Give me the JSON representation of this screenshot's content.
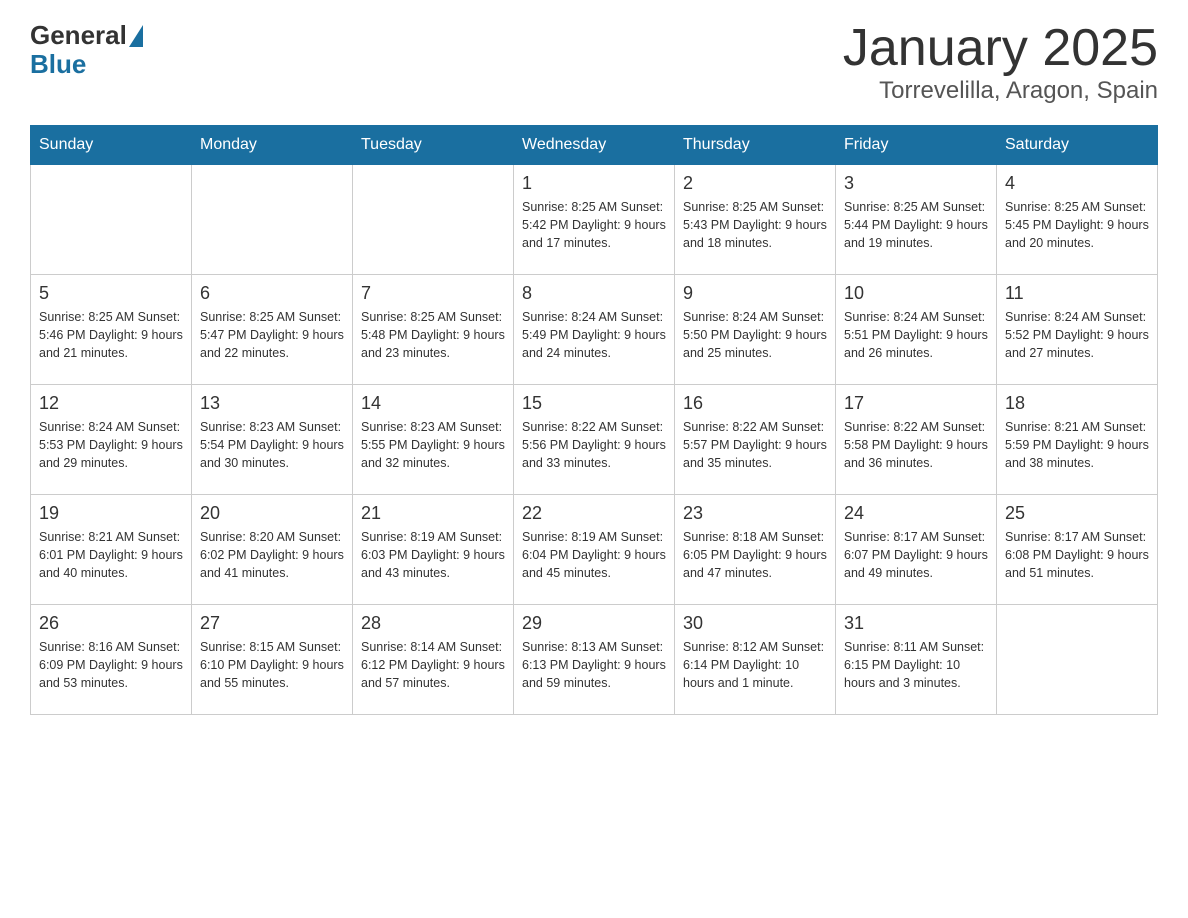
{
  "header": {
    "logo_general": "General",
    "logo_blue": "Blue",
    "title": "January 2025",
    "subtitle": "Torrevelilla, Aragon, Spain"
  },
  "days_of_week": [
    "Sunday",
    "Monday",
    "Tuesday",
    "Wednesday",
    "Thursday",
    "Friday",
    "Saturday"
  ],
  "weeks": [
    [
      {
        "day": "",
        "info": ""
      },
      {
        "day": "",
        "info": ""
      },
      {
        "day": "",
        "info": ""
      },
      {
        "day": "1",
        "info": "Sunrise: 8:25 AM\nSunset: 5:42 PM\nDaylight: 9 hours\nand 17 minutes."
      },
      {
        "day": "2",
        "info": "Sunrise: 8:25 AM\nSunset: 5:43 PM\nDaylight: 9 hours\nand 18 minutes."
      },
      {
        "day": "3",
        "info": "Sunrise: 8:25 AM\nSunset: 5:44 PM\nDaylight: 9 hours\nand 19 minutes."
      },
      {
        "day": "4",
        "info": "Sunrise: 8:25 AM\nSunset: 5:45 PM\nDaylight: 9 hours\nand 20 minutes."
      }
    ],
    [
      {
        "day": "5",
        "info": "Sunrise: 8:25 AM\nSunset: 5:46 PM\nDaylight: 9 hours\nand 21 minutes."
      },
      {
        "day": "6",
        "info": "Sunrise: 8:25 AM\nSunset: 5:47 PM\nDaylight: 9 hours\nand 22 minutes."
      },
      {
        "day": "7",
        "info": "Sunrise: 8:25 AM\nSunset: 5:48 PM\nDaylight: 9 hours\nand 23 minutes."
      },
      {
        "day": "8",
        "info": "Sunrise: 8:24 AM\nSunset: 5:49 PM\nDaylight: 9 hours\nand 24 minutes."
      },
      {
        "day": "9",
        "info": "Sunrise: 8:24 AM\nSunset: 5:50 PM\nDaylight: 9 hours\nand 25 minutes."
      },
      {
        "day": "10",
        "info": "Sunrise: 8:24 AM\nSunset: 5:51 PM\nDaylight: 9 hours\nand 26 minutes."
      },
      {
        "day": "11",
        "info": "Sunrise: 8:24 AM\nSunset: 5:52 PM\nDaylight: 9 hours\nand 27 minutes."
      }
    ],
    [
      {
        "day": "12",
        "info": "Sunrise: 8:24 AM\nSunset: 5:53 PM\nDaylight: 9 hours\nand 29 minutes."
      },
      {
        "day": "13",
        "info": "Sunrise: 8:23 AM\nSunset: 5:54 PM\nDaylight: 9 hours\nand 30 minutes."
      },
      {
        "day": "14",
        "info": "Sunrise: 8:23 AM\nSunset: 5:55 PM\nDaylight: 9 hours\nand 32 minutes."
      },
      {
        "day": "15",
        "info": "Sunrise: 8:22 AM\nSunset: 5:56 PM\nDaylight: 9 hours\nand 33 minutes."
      },
      {
        "day": "16",
        "info": "Sunrise: 8:22 AM\nSunset: 5:57 PM\nDaylight: 9 hours\nand 35 minutes."
      },
      {
        "day": "17",
        "info": "Sunrise: 8:22 AM\nSunset: 5:58 PM\nDaylight: 9 hours\nand 36 minutes."
      },
      {
        "day": "18",
        "info": "Sunrise: 8:21 AM\nSunset: 5:59 PM\nDaylight: 9 hours\nand 38 minutes."
      }
    ],
    [
      {
        "day": "19",
        "info": "Sunrise: 8:21 AM\nSunset: 6:01 PM\nDaylight: 9 hours\nand 40 minutes."
      },
      {
        "day": "20",
        "info": "Sunrise: 8:20 AM\nSunset: 6:02 PM\nDaylight: 9 hours\nand 41 minutes."
      },
      {
        "day": "21",
        "info": "Sunrise: 8:19 AM\nSunset: 6:03 PM\nDaylight: 9 hours\nand 43 minutes."
      },
      {
        "day": "22",
        "info": "Sunrise: 8:19 AM\nSunset: 6:04 PM\nDaylight: 9 hours\nand 45 minutes."
      },
      {
        "day": "23",
        "info": "Sunrise: 8:18 AM\nSunset: 6:05 PM\nDaylight: 9 hours\nand 47 minutes."
      },
      {
        "day": "24",
        "info": "Sunrise: 8:17 AM\nSunset: 6:07 PM\nDaylight: 9 hours\nand 49 minutes."
      },
      {
        "day": "25",
        "info": "Sunrise: 8:17 AM\nSunset: 6:08 PM\nDaylight: 9 hours\nand 51 minutes."
      }
    ],
    [
      {
        "day": "26",
        "info": "Sunrise: 8:16 AM\nSunset: 6:09 PM\nDaylight: 9 hours\nand 53 minutes."
      },
      {
        "day": "27",
        "info": "Sunrise: 8:15 AM\nSunset: 6:10 PM\nDaylight: 9 hours\nand 55 minutes."
      },
      {
        "day": "28",
        "info": "Sunrise: 8:14 AM\nSunset: 6:12 PM\nDaylight: 9 hours\nand 57 minutes."
      },
      {
        "day": "29",
        "info": "Sunrise: 8:13 AM\nSunset: 6:13 PM\nDaylight: 9 hours\nand 59 minutes."
      },
      {
        "day": "30",
        "info": "Sunrise: 8:12 AM\nSunset: 6:14 PM\nDaylight: 10 hours\nand 1 minute."
      },
      {
        "day": "31",
        "info": "Sunrise: 8:11 AM\nSunset: 6:15 PM\nDaylight: 10 hours\nand 3 minutes."
      },
      {
        "day": "",
        "info": ""
      }
    ]
  ]
}
